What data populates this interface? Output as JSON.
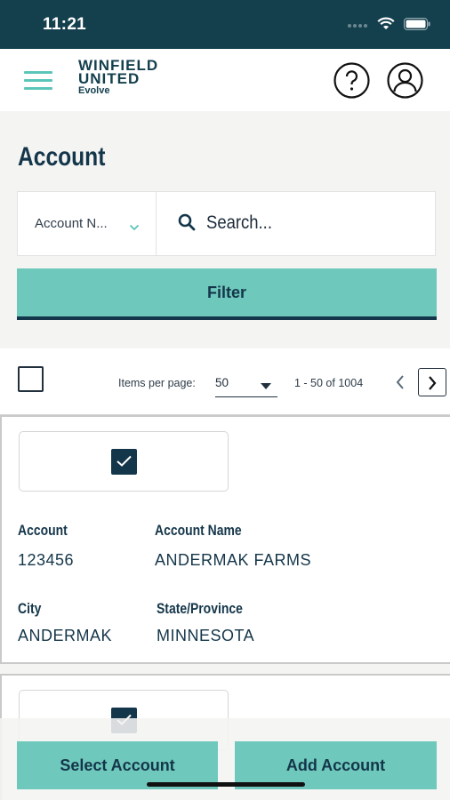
{
  "status_bar": {
    "time": "11:21"
  },
  "header": {
    "logo_line1": "WINFIELD",
    "logo_line2": "UNITED",
    "logo_sub": "Evolve"
  },
  "page": {
    "title": "Account"
  },
  "search": {
    "dropdown_label": "Account N...",
    "placeholder": "Search..."
  },
  "filter_button": "Filter",
  "pagination": {
    "items_per_page_label": "Items per page:",
    "items_per_page_value": "50",
    "range_text": "1 - 50 of 1004"
  },
  "cards": [
    {
      "account_label": "Account",
      "account_value": "123456",
      "name_label": "Account Name",
      "name_value": "ANDERMAK FARMS",
      "city_label": "City",
      "city_value": "ANDERMAK",
      "state_label": "State/Province",
      "state_value": "MINNESOTA",
      "checked": true
    }
  ],
  "actions": {
    "select_account": "Select Account",
    "add_account": "Add Account"
  },
  "colors": {
    "header_dark": "#14404e",
    "teal_accent": "#6fc8bc",
    "navy_text": "#14364a"
  }
}
